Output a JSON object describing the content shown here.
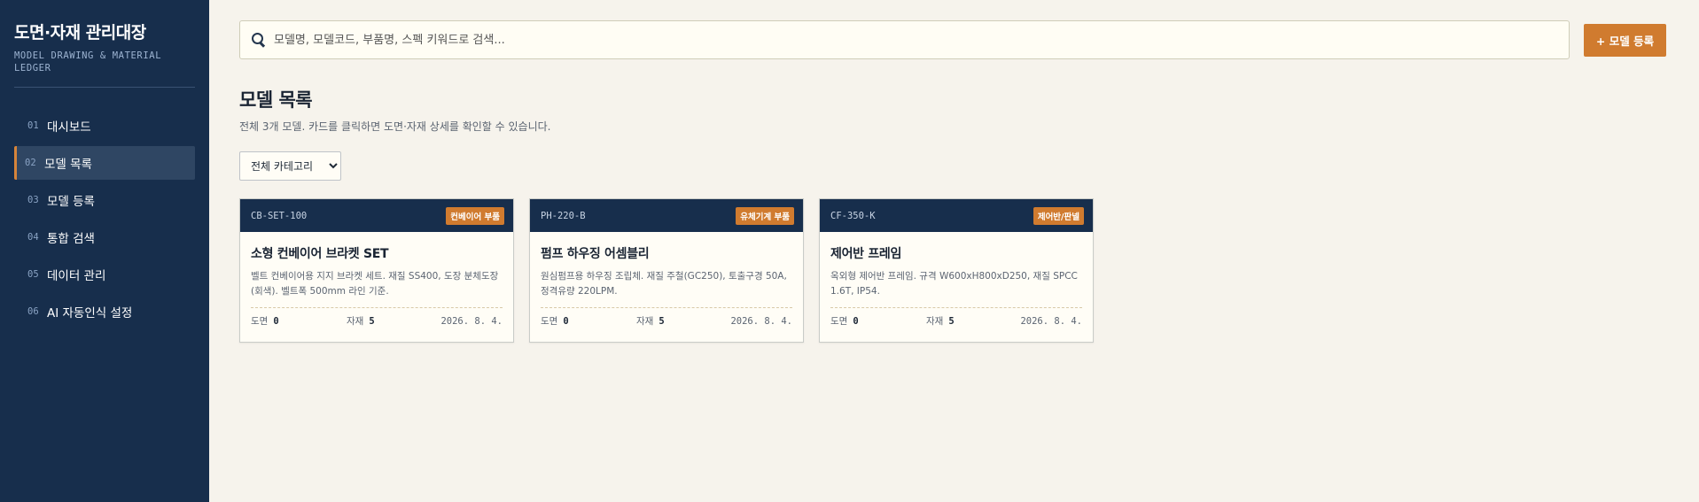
{
  "sidebar": {
    "title": "도면·자재 관리대장",
    "subtitle": "MODEL DRAWING & MATERIAL LEDGER",
    "items": [
      {
        "num": "01",
        "label": "대시보드"
      },
      {
        "num": "02",
        "label": "모델 목록"
      },
      {
        "num": "03",
        "label": "모델 등록"
      },
      {
        "num": "04",
        "label": "통합 검색"
      },
      {
        "num": "05",
        "label": "데이터 관리"
      },
      {
        "num": "06",
        "label": "AI 자동인식 설정"
      }
    ],
    "active_index": 1
  },
  "search": {
    "placeholder": "모델명, 모델코드, 부품명, 스펙 키워드로 검색...",
    "value": ""
  },
  "add_button_label": "+ 모델 등록",
  "page": {
    "title": "모델 목록",
    "description": "전체 3개 모델. 카드를 클릭하면 도면·자재 상세를 확인할 수 있습니다."
  },
  "filter": {
    "selected": "전체 카테고리"
  },
  "labels": {
    "drawings": "도면",
    "materials": "자재"
  },
  "cards": [
    {
      "code": "CB-SET-100",
      "category": "컨베이어 부품",
      "name": "소형 컨베이어 브라켓 SET",
      "description": "벨트 컨베이어용 지지 브라켓 세트. 재질 SS400, 도장 분체도장(회색). 벨트폭 500mm 라인 기준.",
      "drawings": "0",
      "materials": "5",
      "date": "2026. 8. 4."
    },
    {
      "code": "PH-220-B",
      "category": "유체기계 부품",
      "name": "펌프 하우징 어셈블리",
      "description": "원심펌프용 하우징 조립체. 재질 주철(GC250), 토출구경 50A, 정격유량 220LPM.",
      "drawings": "0",
      "materials": "5",
      "date": "2026. 8. 4."
    },
    {
      "code": "CF-350-K",
      "category": "제어반/판넬",
      "name": "제어반 프레임",
      "description": "옥외형 제어반 프레임. 규격 W600xH800xD250, 재질 SPCC 1.6T, IP54.",
      "drawings": "0",
      "materials": "5",
      "date": "2026. 8. 4."
    }
  ],
  "colors": {
    "sidebar_bg": "#172e4c",
    "accent": "#d07b2f",
    "page_bg": "#f6f3ec"
  }
}
